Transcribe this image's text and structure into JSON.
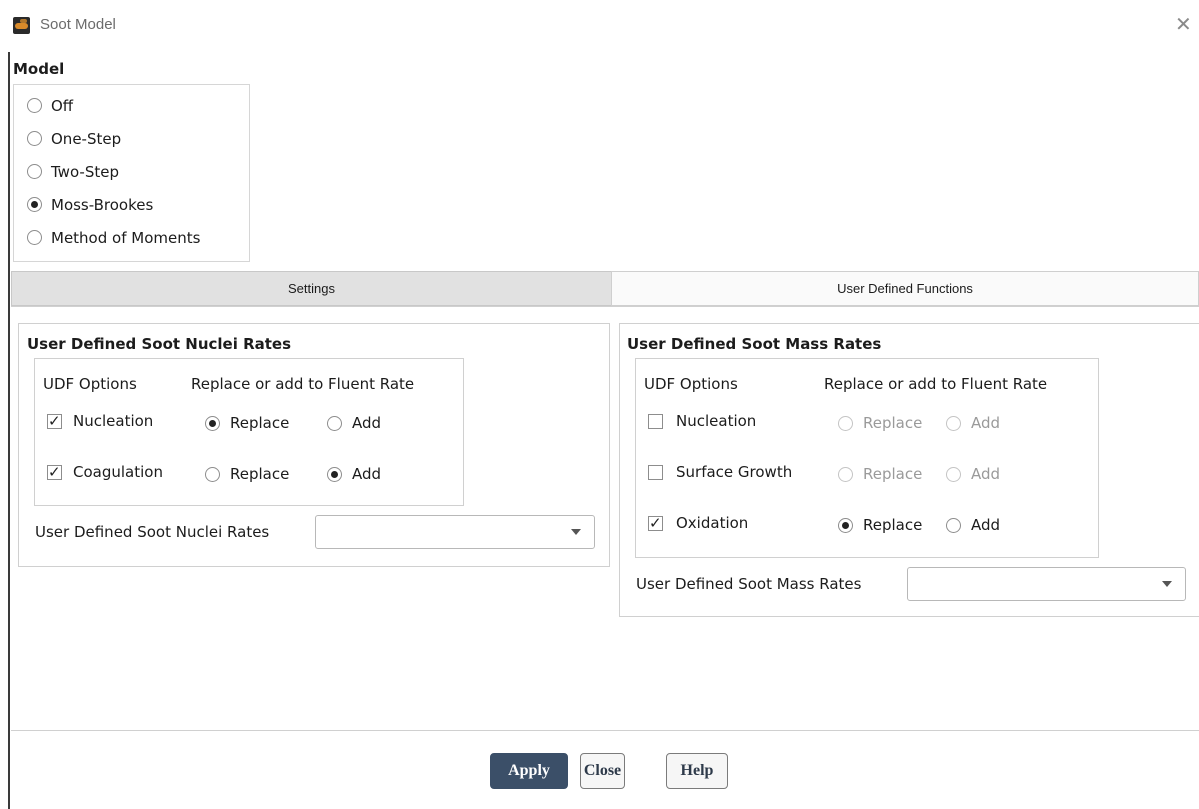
{
  "window": {
    "title": "Soot Model",
    "close_icon": "close-icon"
  },
  "model": {
    "heading": "Model",
    "options": [
      {
        "label": "Off",
        "selected": false
      },
      {
        "label": "One-Step",
        "selected": false
      },
      {
        "label": "Two-Step",
        "selected": false
      },
      {
        "label": "Moss-Brookes",
        "selected": true
      },
      {
        "label": "Method of Moments",
        "selected": false
      }
    ]
  },
  "tabs": [
    {
      "label": "Settings",
      "active": false
    },
    {
      "label": "User Defined Functions",
      "active": true
    }
  ],
  "nuclei": {
    "heading": "User Defined Soot Nuclei Rates",
    "col_udf": "UDF Options",
    "col_replace": "Replace or add to Fluent Rate",
    "rows": [
      {
        "label": "Nucleation",
        "checked": true,
        "mode": "Replace"
      },
      {
        "label": "Coagulation",
        "checked": true,
        "mode": "Add"
      }
    ],
    "replace_label": "Replace",
    "add_label": "Add",
    "dropdown_label": "User Defined Soot Nuclei Rates",
    "dropdown_value": ""
  },
  "mass": {
    "heading": "User Defined Soot Mass Rates",
    "col_udf": "UDF Options",
    "col_replace": "Replace or add to Fluent Rate",
    "rows": [
      {
        "label": "Nucleation",
        "checked": false,
        "mode": ""
      },
      {
        "label": "Surface Growth",
        "checked": false,
        "mode": ""
      },
      {
        "label": "Oxidation",
        "checked": true,
        "mode": "Replace"
      }
    ],
    "replace_label": "Replace",
    "add_label": "Add",
    "dropdown_label": "User Defined Soot Mass Rates",
    "dropdown_value": ""
  },
  "buttons": {
    "apply": "Apply",
    "close": "Close",
    "help": "Help"
  },
  "colors": {
    "primary_button": "#3b4f68",
    "tab_active": "#fafafa",
    "tab_inactive": "#e1e1e1"
  }
}
